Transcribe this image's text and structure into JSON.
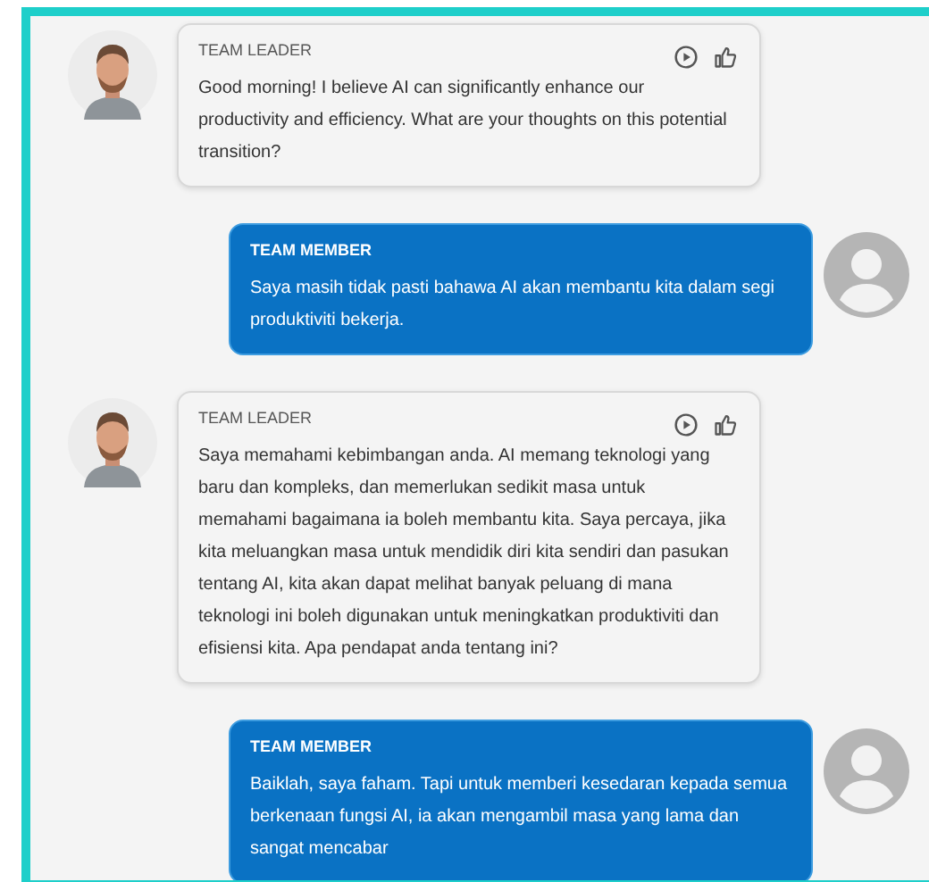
{
  "messages": [
    {
      "kind": "received",
      "sender": "TEAM LEADER",
      "text": "Good morning! I believe AI can significantly enhance our productivity and efficiency. What are your thoughts on this potential transition?"
    },
    {
      "kind": "sent",
      "sender": "TEAM MEMBER",
      "text": "Saya masih tidak pasti bahawa AI akan membantu kita dalam segi produktiviti bekerja."
    },
    {
      "kind": "received",
      "sender": "TEAM LEADER",
      "text": "Saya memahami kebimbangan anda. AI memang teknologi yang baru dan kompleks, dan memerlukan sedikit masa untuk memahami bagaimana ia boleh membantu kita. Saya percaya, jika kita meluangkan masa untuk mendidik diri kita sendiri dan pasukan tentang AI, kita akan dapat melihat banyak peluang di mana teknologi ini boleh digunakan untuk meningkatkan produktiviti dan efisiensi kita. Apa pendapat anda tentang ini?"
    },
    {
      "kind": "sent",
      "sender": "TEAM MEMBER",
      "text": "Baiklah, saya faham. Tapi untuk memberi kesedaran kepada semua berkenaan fungsi AI, ia akan mengambil masa yang lama dan sangat mencabar"
    }
  ]
}
